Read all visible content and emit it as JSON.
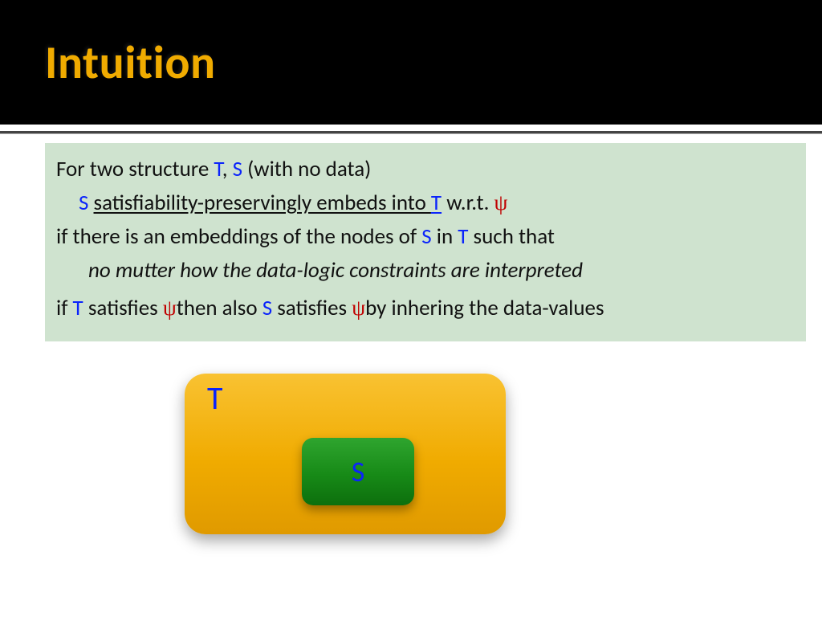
{
  "title": "Intuition",
  "panel": {
    "l1a": "For two structure ",
    "l1_T": "T",
    "l1_comma": ", ",
    "l1_S": "S",
    "l1b": " (with no data)",
    "l2_S": "S",
    "l2_space": " ",
    "l2_emb": "satisfiability-preservingly embeds into ",
    "l2_T": "T",
    "l2_wrt": " w.r.t. ",
    "psi": "ψ",
    "l3a": "if there is an embeddings of the nodes of ",
    "l3_S": "S",
    "l3_in": " in ",
    "l3_T": "T",
    "l3b": " such that",
    "l4": "no mutter how the data-logic constraints are interpreted",
    "l5a": "if ",
    "l5_T": "T",
    "l5b": " satisfies ",
    "l5c": "then also ",
    "l5_S": "S",
    "l5d": " satisfies ",
    "l5e": "by inhering the data-values"
  },
  "diagram": {
    "T_label": "T",
    "S_label": "S"
  },
  "colors": {
    "title": "#f0ab00",
    "panel_bg": "#cfe3cf",
    "symbol_blue": "#0b24fb",
    "psi_red": "#c00000",
    "box_t": "#f0ab00",
    "box_s": "#178a17"
  }
}
